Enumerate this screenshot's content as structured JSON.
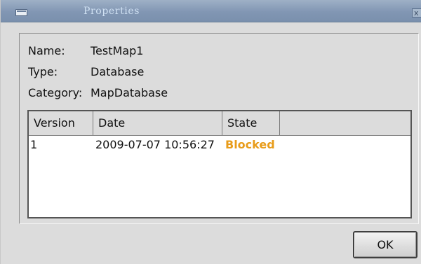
{
  "window": {
    "title": "Properties",
    "title_color": "#cfe0f2",
    "titlebar_color": "#8196b3",
    "menu_icon": "window-menu-icon",
    "close_icon": "close-icon",
    "close_glyph": "x"
  },
  "properties": {
    "name_label": "Name:",
    "name_value": "TestMap1",
    "type_label": "Type:",
    "type_value": "Database",
    "category_label": "Category:",
    "category_value": "MapDatabase"
  },
  "table": {
    "columns": [
      "Version",
      "Date",
      "State",
      ""
    ],
    "rows": [
      {
        "version": "1",
        "date": "2009-07-07 10:56:27",
        "state": "Blocked",
        "state_color": "#e89c1a"
      }
    ]
  },
  "buttons": {
    "ok_label": "OK"
  }
}
